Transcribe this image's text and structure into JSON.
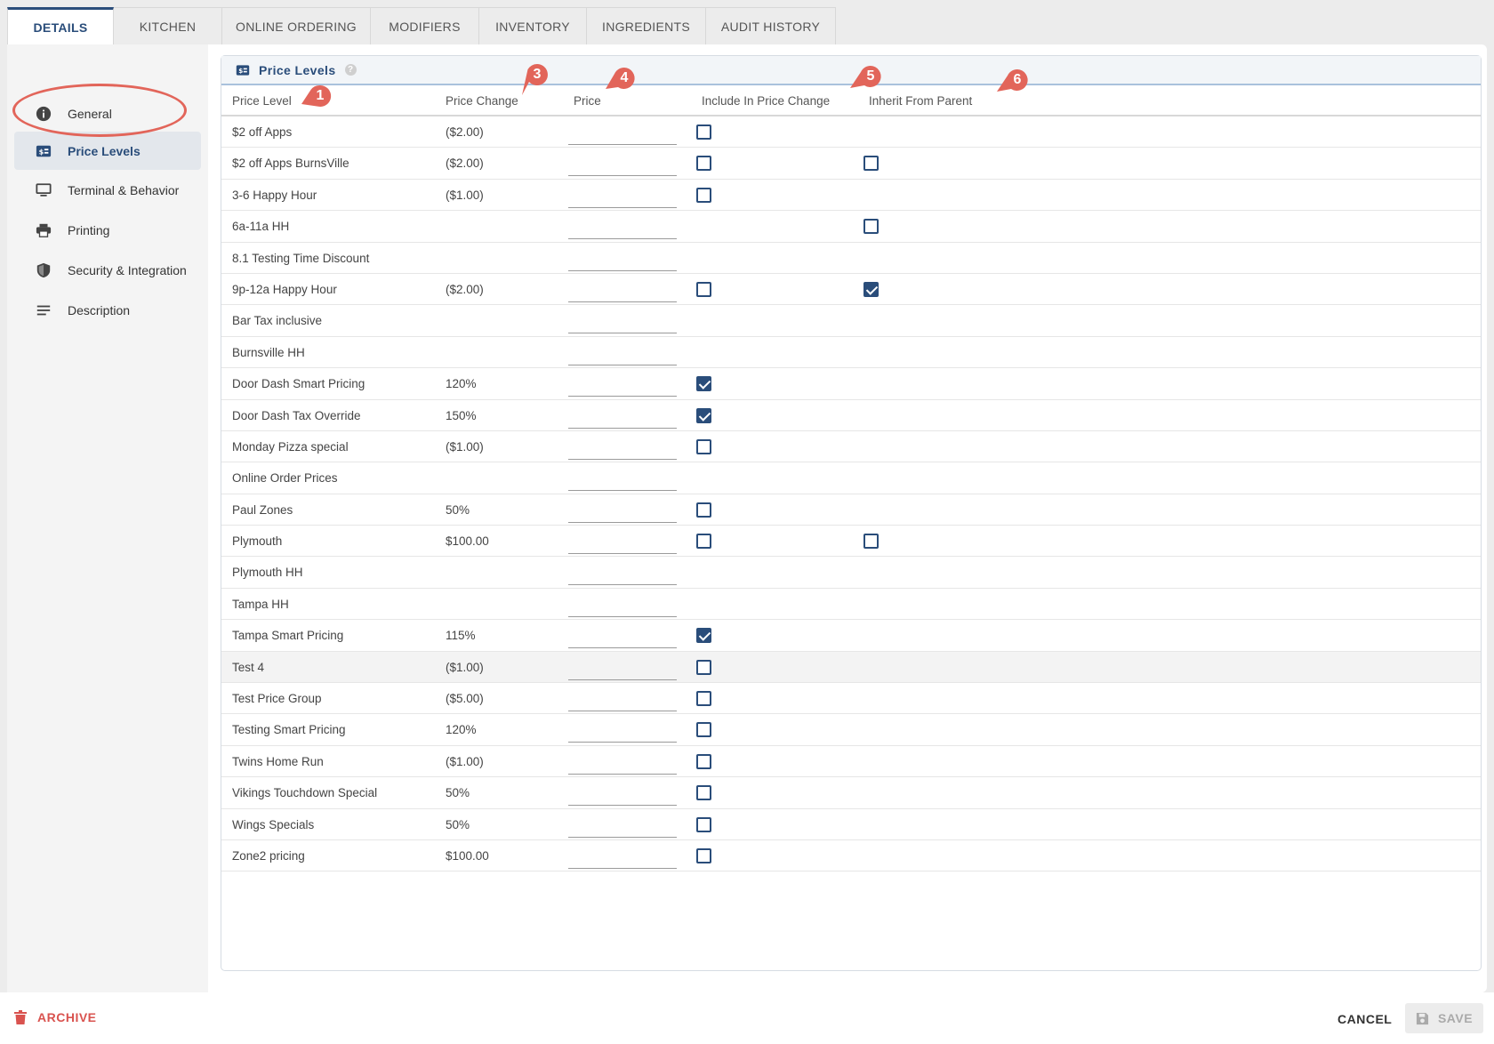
{
  "tabs": [
    {
      "label": "DETAILS",
      "active": true
    },
    {
      "label": "KITCHEN",
      "active": false
    },
    {
      "label": "ONLINE ORDERING",
      "active": false
    },
    {
      "label": "MODIFIERS",
      "active": false
    },
    {
      "label": "INVENTORY",
      "active": false
    },
    {
      "label": "INGREDIENTS",
      "active": false
    },
    {
      "label": "AUDIT HISTORY",
      "active": false
    }
  ],
  "sidebar": {
    "items": [
      {
        "label": "General",
        "icon": "info-icon",
        "active": false
      },
      {
        "label": "Price Levels",
        "icon": "price-tag-icon",
        "active": true
      },
      {
        "label": "Terminal & Behavior",
        "icon": "monitor-icon",
        "active": false
      },
      {
        "label": "Printing",
        "icon": "printer-icon",
        "active": false
      },
      {
        "label": "Security & Integration",
        "icon": "shield-icon",
        "active": false
      },
      {
        "label": "Description",
        "icon": "text-lines-icon",
        "active": false
      }
    ]
  },
  "panel": {
    "title": "Price Levels",
    "help": "?",
    "columns": {
      "price_level": "Price Level",
      "price_change": "Price Change",
      "price": "Price",
      "include": "Include In Price Change",
      "inherit": "Inherit From Parent"
    },
    "rows": [
      {
        "name": "$2 off Apps",
        "change": "($2.00)",
        "include": false,
        "inherit": null
      },
      {
        "name": "$2 off Apps BurnsVille",
        "change": "($2.00)",
        "include": false,
        "inherit": false
      },
      {
        "name": "3-6 Happy Hour",
        "change": "($1.00)",
        "include": false,
        "inherit": null
      },
      {
        "name": "6a-11a HH",
        "change": "",
        "include": null,
        "inherit": false
      },
      {
        "name": "8.1 Testing Time Discount",
        "change": "",
        "include": null,
        "inherit": null
      },
      {
        "name": "9p-12a Happy Hour",
        "change": "($2.00)",
        "include": false,
        "inherit": true
      },
      {
        "name": "Bar Tax inclusive",
        "change": "",
        "include": null,
        "inherit": null
      },
      {
        "name": "Burnsville HH",
        "change": "",
        "include": null,
        "inherit": null
      },
      {
        "name": "Door Dash Smart Pricing",
        "change": "120%",
        "include": true,
        "inherit": null
      },
      {
        "name": "Door Dash Tax Override",
        "change": "150%",
        "include": true,
        "inherit": null
      },
      {
        "name": "Monday Pizza special",
        "change": "($1.00)",
        "include": false,
        "inherit": null
      },
      {
        "name": "Online Order Prices",
        "change": "",
        "include": null,
        "inherit": null
      },
      {
        "name": "Paul Zones",
        "change": "50%",
        "include": false,
        "inherit": null
      },
      {
        "name": "Plymouth",
        "change": "$100.00",
        "include": false,
        "inherit": false
      },
      {
        "name": "Plymouth HH",
        "change": "",
        "include": null,
        "inherit": null
      },
      {
        "name": "Tampa HH",
        "change": "",
        "include": null,
        "inherit": null
      },
      {
        "name": "Tampa Smart Pricing",
        "change": "115%",
        "include": true,
        "inherit": null
      },
      {
        "name": "Test 4",
        "change": "($1.00)",
        "include": false,
        "inherit": null,
        "highlight": true
      },
      {
        "name": "Test Price Group",
        "change": "($5.00)",
        "include": false,
        "inherit": null
      },
      {
        "name": "Testing Smart Pricing",
        "change": "120%",
        "include": false,
        "inherit": null
      },
      {
        "name": "Twins Home Run",
        "change": "($1.00)",
        "include": false,
        "inherit": null
      },
      {
        "name": "Vikings Touchdown Special",
        "change": "50%",
        "include": false,
        "inherit": null
      },
      {
        "name": "Wings Specials",
        "change": "50%",
        "include": false,
        "inherit": null
      },
      {
        "name": "Zone2 pricing",
        "change": "$100.00",
        "include": false,
        "inherit": null
      }
    ]
  },
  "callouts": [
    "1",
    "3",
    "4",
    "5",
    "6"
  ],
  "footer": {
    "archive_label": "ARCHIVE",
    "cancel_label": "CANCEL",
    "save_label": "SAVE"
  },
  "colors": {
    "accent": "#2a4d7a",
    "annotation": "#e2655a",
    "danger": "#d9534f"
  }
}
